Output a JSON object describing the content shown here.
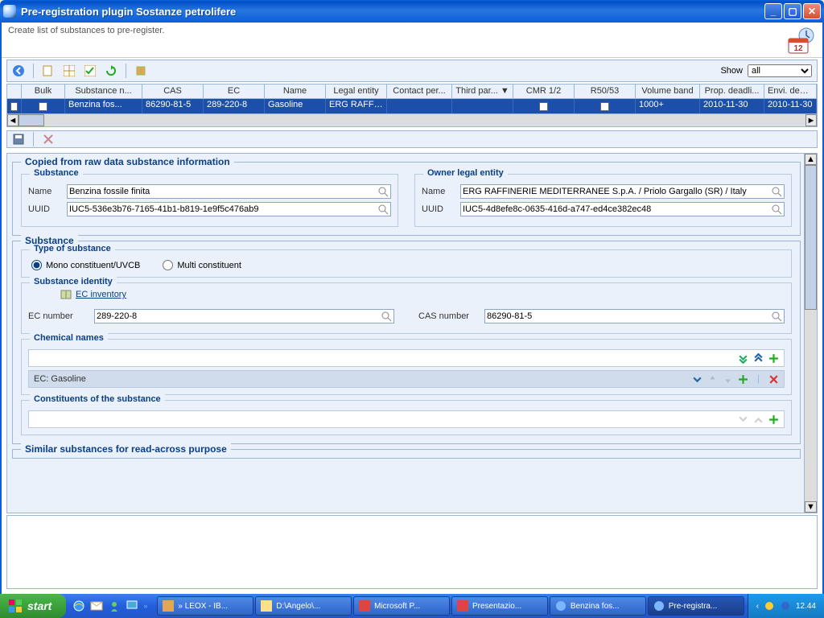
{
  "window": {
    "title": "Pre-registration plugin Sostanze petrolifere",
    "subtitle": "Create list of substances to pre-register."
  },
  "toolbar": {
    "show_label": "Show",
    "show_value": "all"
  },
  "grid": {
    "headers": [
      "Bulk",
      "Substance n...",
      "CAS",
      "EC",
      "Name",
      "Legal entity",
      "Contact per...",
      "Third par... ▼",
      "CMR 1/2",
      "R50/53",
      "Volume band",
      "Prop. deadli...",
      "Envi. deadline"
    ],
    "row": [
      "",
      "Benzina fos...",
      "86290-81-5",
      "289-220-8",
      "Gasoline",
      "ERG RAFFIN...",
      "",
      "",
      "",
      "",
      "1000+",
      "2010-11-30",
      "2010-11-30"
    ]
  },
  "form": {
    "copied_legend": "Copied from raw data substance information",
    "substance_box": {
      "legend": "Substance",
      "name_label": "Name",
      "name_value": "Benzina fossile finita",
      "uuid_label": "UUID",
      "uuid_value": "IUC5-536e3b76-7165-41b1-b819-1e9f5c476ab9"
    },
    "owner_box": {
      "legend": "Owner legal entity",
      "name_label": "Name",
      "name_value": "ERG RAFFINERIE MEDITERRANEE S.p.A. / Priolo Gargallo (SR) / Italy",
      "uuid_label": "UUID",
      "uuid_value": "IUC5-4d8efe8c-0635-416d-a747-ed4ce382ec48"
    },
    "substance_legend": "Substance",
    "type_legend": "Type of substance",
    "radio_mono": "Mono constituent/UVCB",
    "radio_multi": "Multi constituent",
    "identity_legend": "Substance identity",
    "ec_inventory": "EC inventory",
    "ec_label": "EC number",
    "ec_value": "289-220-8",
    "cas_label": "CAS number",
    "cas_value": "86290-81-5",
    "chemnames_legend": "Chemical names",
    "chem_item": "EC: Gasoline",
    "constituents_legend": "Constituents of the substance",
    "similar_legend": "Similar substances for read-across purpose"
  },
  "taskbar": {
    "start": "start",
    "tasks": [
      "» LEOX - IB...",
      "D:\\Angelo\\...",
      "Microsoft P...",
      "Presentazio...",
      "Benzina fos...",
      "Pre-registra..."
    ],
    "time": "12.44"
  }
}
